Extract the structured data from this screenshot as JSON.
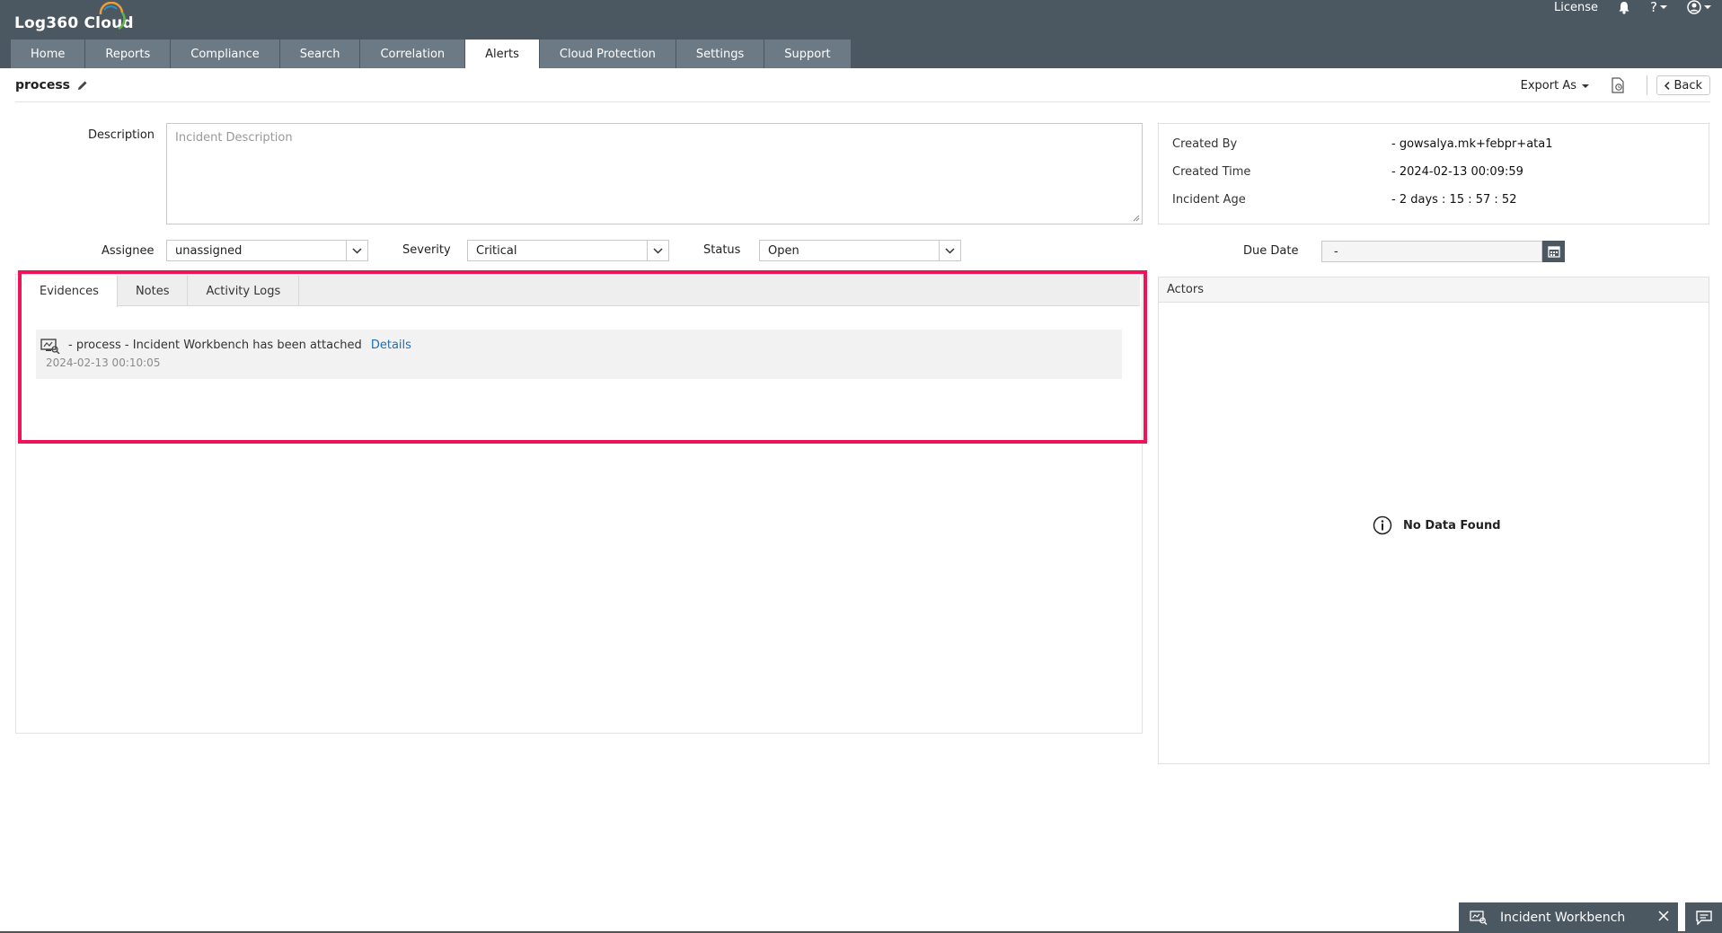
{
  "app": {
    "title": "Log360 Cloud"
  },
  "top_right": {
    "license": "License",
    "help": "?"
  },
  "nav": {
    "tabs": [
      "Home",
      "Reports",
      "Compliance",
      "Search",
      "Correlation",
      "Alerts",
      "Cloud Protection",
      "Settings",
      "Support"
    ],
    "active": "Alerts"
  },
  "incident": {
    "title": "process"
  },
  "toolbar": {
    "export_label": "Export As",
    "back_label": "Back"
  },
  "form": {
    "description_label": "Description",
    "description_placeholder": "Incident Description",
    "assignee_label": "Assignee",
    "assignee_value": "unassigned",
    "severity_label": "Severity",
    "severity_value": "Critical",
    "status_label": "Status",
    "status_value": "Open",
    "due_date_label": "Due Date",
    "due_date_value": "-"
  },
  "info": {
    "created_by_label": "Created By",
    "created_by_value": "- gowsalya.mk+febpr+ata1",
    "created_time_label": "Created Time",
    "created_time_value": "- 2024-02-13 00:09:59",
    "incident_age_label": "Incident Age",
    "incident_age_value": "- 2 days : 15 : 57 : 52"
  },
  "tabs": {
    "evidences": "Evidences",
    "notes": "Notes",
    "activity_logs": "Activity Logs"
  },
  "evidence": {
    "text": "-   process - Incident Workbench has been attached",
    "link": "Details",
    "time": "2024-02-13 00:10:05"
  },
  "actors": {
    "title": "Actors",
    "empty": "No Data Found"
  },
  "workbench": {
    "label": "Incident Workbench"
  },
  "colors": {
    "header": "#4c5861",
    "nav_tab": "#6c7a85",
    "highlight": "#ef1358",
    "link": "#1a6fb5"
  }
}
